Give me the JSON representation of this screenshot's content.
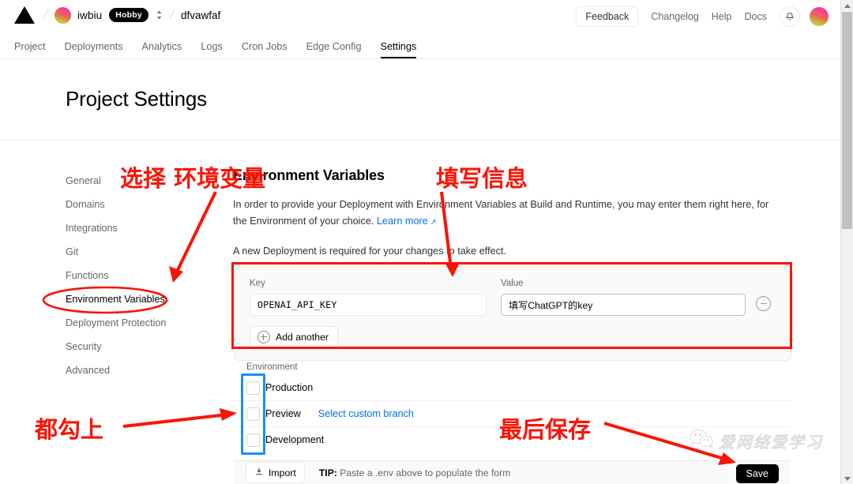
{
  "header": {
    "logo_icon": "vercel-triangle-logo",
    "org_name": "iwbiu",
    "plan_badge": "Hobby",
    "project_name": "dfvawfaf",
    "feedback_label": "Feedback",
    "changelog_label": "Changelog",
    "help_label": "Help",
    "docs_label": "Docs",
    "bell_icon": "notification-bell-icon",
    "avatar_icon": "user-avatar"
  },
  "tabs": [
    {
      "label": "Project",
      "active": false
    },
    {
      "label": "Deployments",
      "active": false
    },
    {
      "label": "Analytics",
      "active": false
    },
    {
      "label": "Logs",
      "active": false
    },
    {
      "label": "Cron Jobs",
      "active": false
    },
    {
      "label": "Edge Config",
      "active": false
    },
    {
      "label": "Settings",
      "active": true
    }
  ],
  "page": {
    "title": "Project Settings"
  },
  "sidebar": {
    "items": [
      {
        "label": "General",
        "active": false
      },
      {
        "label": "Domains",
        "active": false
      },
      {
        "label": "Integrations",
        "active": false
      },
      {
        "label": "Git",
        "active": false
      },
      {
        "label": "Functions",
        "active": false
      },
      {
        "label": "Environment Variables",
        "active": true
      },
      {
        "label": "Deployment Protection",
        "active": false
      },
      {
        "label": "Security",
        "active": false
      },
      {
        "label": "Advanced",
        "active": false
      }
    ]
  },
  "main": {
    "section_title": "Environment Variables",
    "description_part1": "In order to provide your Deployment with Environment Variables at Build and Runtime, you may enter them right here, for the Environment of your choice. ",
    "learn_more_label": "Learn more",
    "external_link_icon": "external-link-icon",
    "note": "A new Deployment is required for your changes to take effect."
  },
  "form": {
    "key_label": "Key",
    "key_value": "OPENAI_API_KEY",
    "value_label": "Value",
    "value_value": "填写ChatGPT的key",
    "remove_icon": "circle-minus-icon",
    "add_icon": "circle-plus-icon",
    "add_another_label": "Add another",
    "environment_label": "Environment",
    "environments": [
      {
        "name": "Production",
        "checked": false
      },
      {
        "name": "Preview",
        "checked": false,
        "link": "Select custom branch"
      },
      {
        "name": "Development",
        "checked": false
      }
    ]
  },
  "footer": {
    "import_icon": "download-import-icon",
    "import_label": "Import",
    "tip_prefix": "TIP:",
    "tip_text": " Paste a .env above to populate the form",
    "save_label": "Save"
  },
  "annotations": {
    "select_env_var": "选择 环境变量",
    "fill_info": "填写信息",
    "check_all": "都勾上",
    "save_last": "最后保存",
    "color": "#fb1303",
    "blue_color": "#1a8cff"
  },
  "watermark": {
    "wechat_icon": "wechat-logo-icon",
    "text": "爱网络爱学习"
  },
  "scrollbar": {
    "up_icon": "scroll-up-arrow-icon",
    "down_icon": "scroll-down-arrow-icon",
    "thumb": "scroll-thumb"
  }
}
